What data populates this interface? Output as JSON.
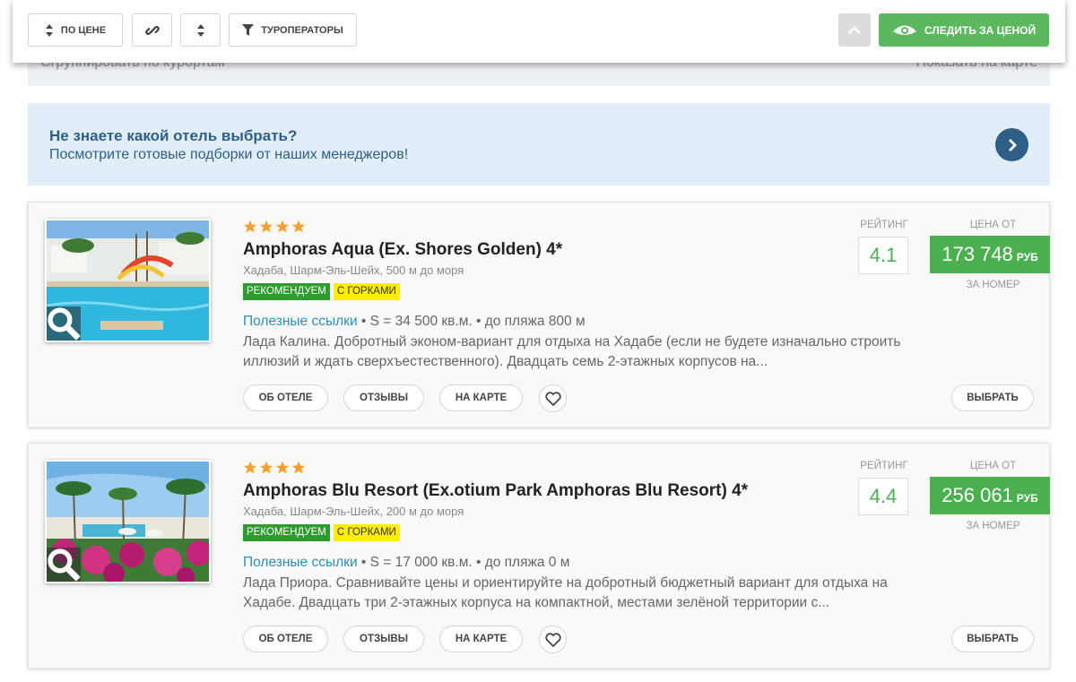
{
  "group_bar": {
    "group_label": "Сгруппировать по курортам",
    "map_label": "Показать на карте"
  },
  "toolbar": {
    "sort_label": "ПО ЦЕНЕ",
    "operators_label": "ТУРОПЕРАТОРЫ",
    "follow_label": "СЛЕДИТЬ ЗА ЦЕНОЙ"
  },
  "promo": {
    "question": "Не знаете какой отель выбрать?",
    "subtitle": "Посмотрите готовые подборки от наших менеджеров!"
  },
  "common": {
    "rating_label": "РЕЙТИНГ",
    "price_from_label": "ЦЕНА ОТ",
    "currency": "РУБ",
    "per_room": "ЗА НОМЕР",
    "useful_links": "Полезные ссылки",
    "about_btn": "ОБ ОТЕЛЕ",
    "reviews_btn": "ОТЗЫВЫ",
    "map_btn": "НА КАРТЕ",
    "choose_btn": "ВЫБРАТЬ"
  },
  "hotels": [
    {
      "stars": 4,
      "name": "Amphoras Aqua (Ex. Shores Golden) 4*",
      "location": "Хадаба, Шарм-Эль-Шейх, 500 м до моря",
      "badges": [
        "РЕКОМЕНДУЕМ",
        "С ГОРКАМИ"
      ],
      "facts": " • S = 34 500 кв.м. • до пляжа 800 м",
      "description": "Лада Калина. Добротный эконом-вариант для отдыха на Хадабе (если не будете изначально строить иллюзий и ждать сверхъестественного). Двадцать семь 2-этажных корпусов на...",
      "rating": "4.1",
      "price": "173 748"
    },
    {
      "stars": 4,
      "name": "Amphoras Blu Resort (Ex.otium Park Amphoras Blu Resort) 4*",
      "location": "Хадаба, Шарм-Эль-Шейх, 200 м до моря",
      "badges": [
        "РЕКОМЕНДУЕМ",
        "С ГОРКАМИ"
      ],
      "facts": " • S = 17 000 кв.м. • до пляжа 0 м",
      "description": "Лада Приора. Сравнивайте цены и ориентируйте на добротный бюджетный вариант для отдыха на Хадабе. Двадцать три 2-этажных корпуса на компактной, местами зелёной территории с...",
      "rating": "4.4",
      "price": "256 061"
    }
  ],
  "colors": {
    "green": "#4caf50",
    "badge_green": "#2e9b2e",
    "badge_yellow": "#ffee00",
    "link": "#2d8fb6",
    "promo_bg": "#e1eefa",
    "promo_text": "#2f5f86",
    "star": "#f0a030"
  }
}
